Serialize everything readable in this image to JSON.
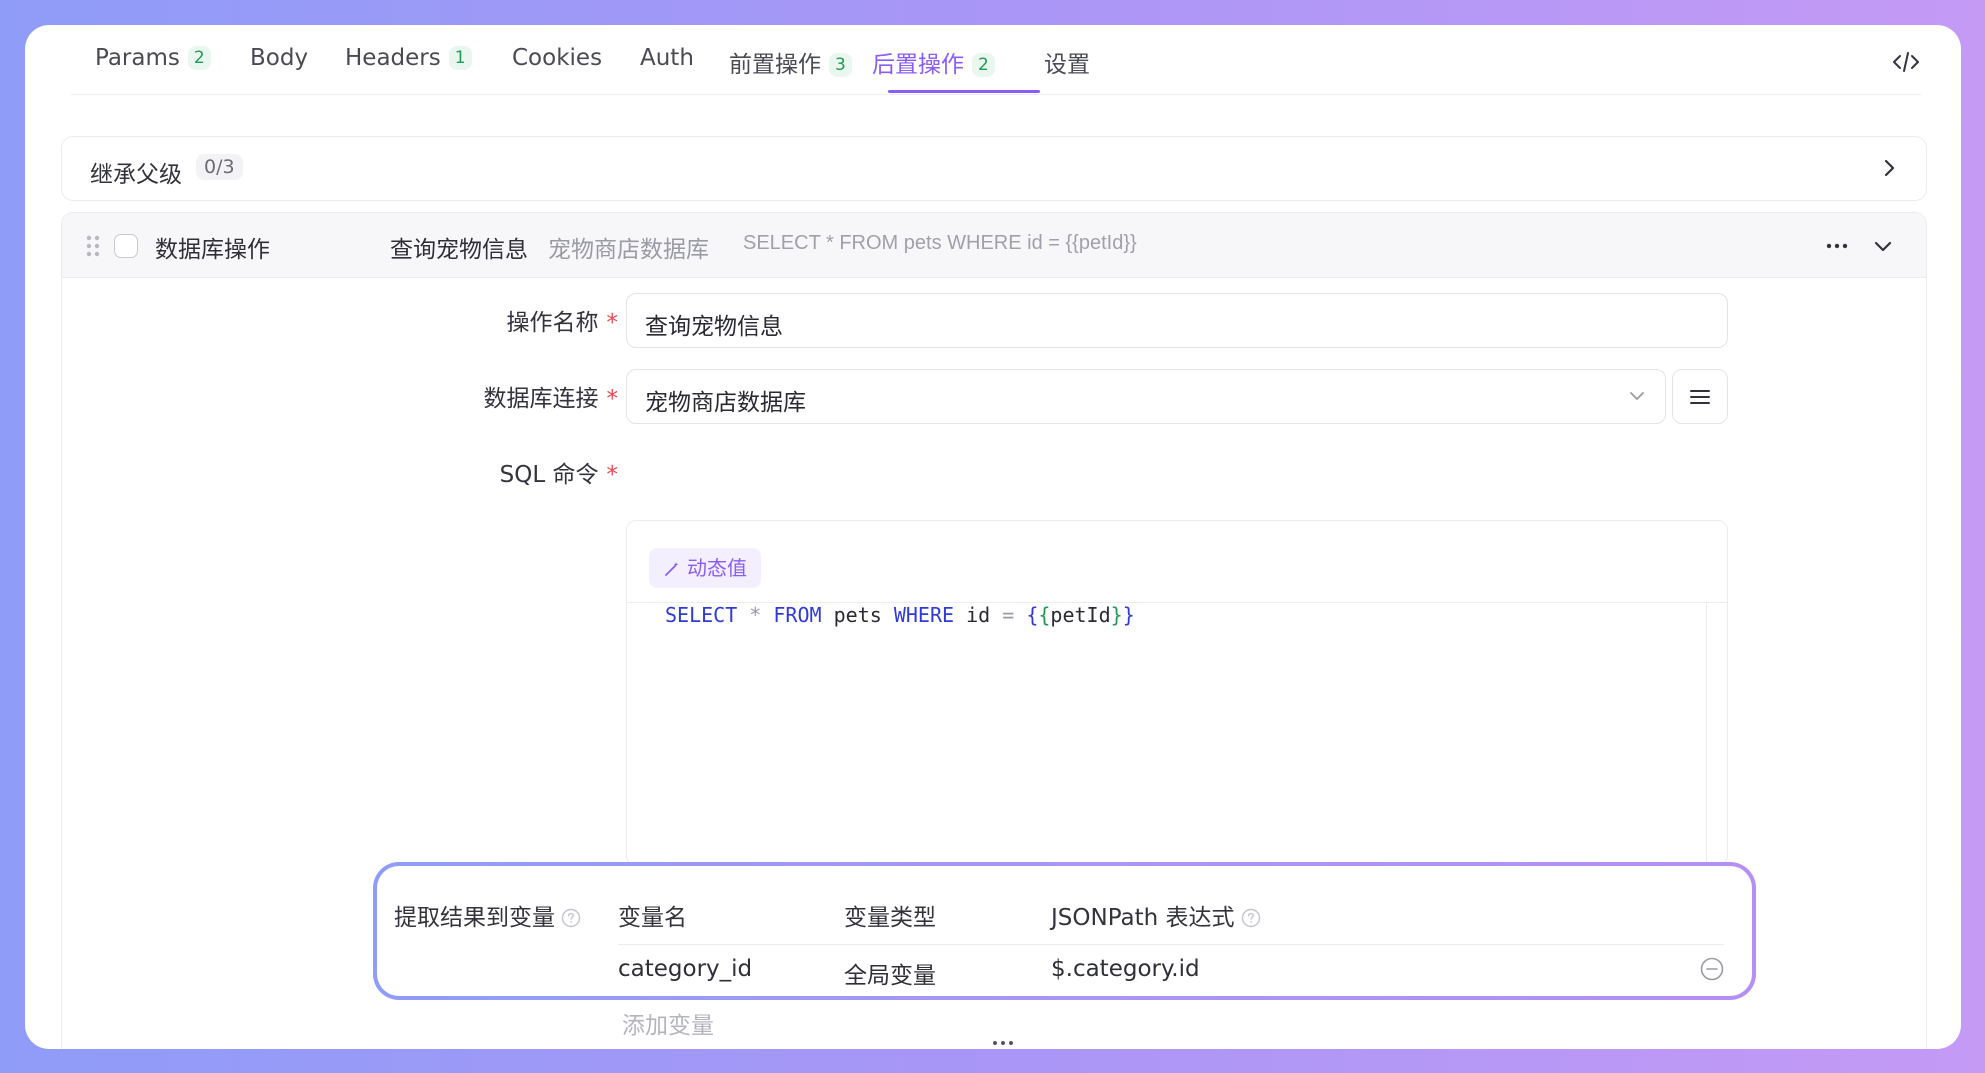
{
  "tabs": [
    {
      "label": "Params",
      "badge": "2"
    },
    {
      "label": "Body",
      "badge": ""
    },
    {
      "label": "Headers",
      "badge": "1"
    },
    {
      "label": "Cookies",
      "badge": ""
    },
    {
      "label": "Auth",
      "badge": ""
    },
    {
      "label": "前置操作",
      "badge": "3"
    },
    {
      "label": "后置操作",
      "badge": "2"
    },
    {
      "label": "设置",
      "badge": ""
    }
  ],
  "active_tab": "后置操作",
  "inherit": {
    "label": "继承父级",
    "count": "0/3"
  },
  "operation": {
    "type": "数据库操作",
    "name": "查询宠物信息",
    "connection": "宠物商店数据库",
    "sql_preview": "SELECT * FROM pets WHERE id = {{petId}}"
  },
  "form": {
    "name_label": "操作名称",
    "name_value": "查询宠物信息",
    "conn_label": "数据库连接",
    "conn_value": "宠物商店数据库",
    "sql_label": "SQL 命令",
    "required_mark": "*",
    "dynamic_value_label": "动态值",
    "sql_tokens": {
      "select": "SELECT",
      "star": "*",
      "from": "FROM",
      "table": "pets",
      "where": "WHERE",
      "col": "id",
      "eq": "=",
      "open1": "{",
      "open2": "{",
      "var": "petId",
      "close2": "}",
      "close1": "}"
    }
  },
  "extract": {
    "title": "提取结果到变量",
    "headers": {
      "name": "变量名",
      "type": "变量类型",
      "expr": "JSONPath 表达式"
    },
    "rows": [
      {
        "name": "category_id",
        "type": "全局变量",
        "expr": "$.category.id"
      }
    ],
    "add_label": "添加变量"
  },
  "colors": {
    "accent": "#8b5cf6",
    "badge_green": "#1f9a57",
    "required": "#e5484d"
  }
}
